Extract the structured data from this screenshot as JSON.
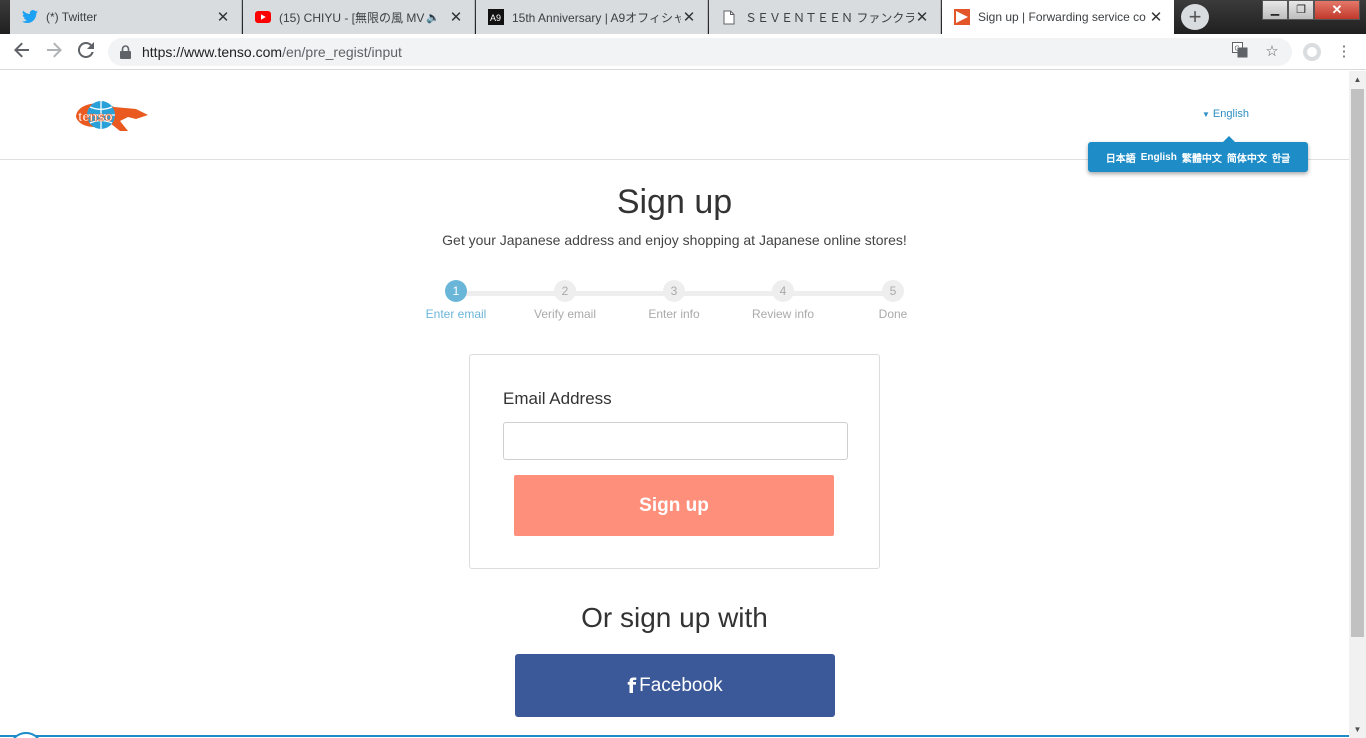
{
  "browser": {
    "tabs": [
      {
        "title": "(*) Twitter",
        "icon": "twitter-icon"
      },
      {
        "title": "(15) CHIYU - [無限の風 MV",
        "icon": "youtube-icon"
      },
      {
        "title": "15th Anniversary | A9オフィシャ",
        "icon": "a9-icon"
      },
      {
        "title": "ＳＥＶＥＮＴＥＥＮ ファンクラ",
        "icon": "document-icon"
      },
      {
        "title": "Sign up | Forwarding service co",
        "icon": "tenso-icon"
      }
    ],
    "new_tab": "+",
    "url_host": "https://www.tenso.com",
    "url_path": "/en/pre_regist/input",
    "window_controls": {
      "minimize": "▁",
      "maximize": "❐",
      "close": "✕"
    }
  },
  "header": {
    "logo_text": "tenso",
    "language_current": "English",
    "languages": [
      "日本語",
      "English",
      "繁體中文",
      "简体中文",
      "한글"
    ]
  },
  "main": {
    "title": "Sign up",
    "subtitle": "Get your Japanese address and enjoy shopping at Japanese online stores!",
    "steps": [
      {
        "num": "1",
        "label": "Enter email"
      },
      {
        "num": "2",
        "label": "Verify email"
      },
      {
        "num": "3",
        "label": "Enter info"
      },
      {
        "num": "4",
        "label": "Review info"
      },
      {
        "num": "5",
        "label": "Done"
      }
    ],
    "active_step": 1,
    "form": {
      "email_label": "Email Address",
      "email_value": "",
      "submit_label": "Sign up"
    },
    "alt_title": "Or sign up with",
    "facebook_icon": "f",
    "facebook_label": "Facebook"
  },
  "colors": {
    "accent_blue": "#1d8cc7",
    "step_active": "#6ab6d8",
    "signup_button": "#fe907b",
    "facebook": "#3b5998"
  }
}
